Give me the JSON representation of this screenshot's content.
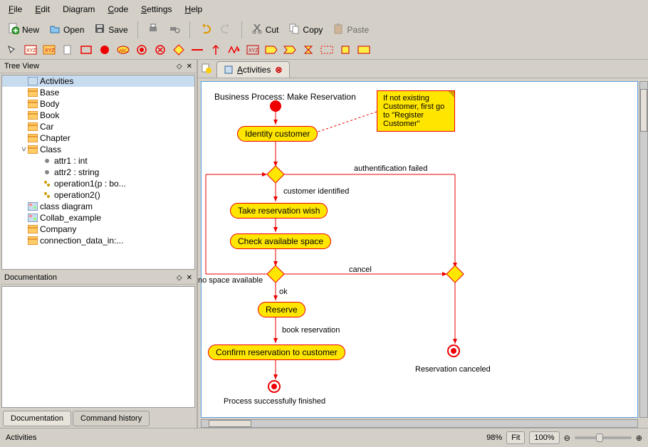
{
  "menu": [
    "File",
    "Edit",
    "Diagram",
    "Code",
    "Settings",
    "Help"
  ],
  "toolbar1": {
    "new": "New",
    "open": "Open",
    "save": "Save",
    "cut": "Cut",
    "copy": "Copy",
    "paste": "Paste"
  },
  "tree": {
    "title": "Tree View",
    "items": [
      {
        "label": "Activities",
        "indent": 34,
        "sel": true,
        "icon": "act"
      },
      {
        "label": "Base",
        "indent": 34,
        "icon": "cls"
      },
      {
        "label": "Body",
        "indent": 34,
        "icon": "cls"
      },
      {
        "label": "Book",
        "indent": 34,
        "icon": "cls"
      },
      {
        "label": "Car",
        "indent": 34,
        "icon": "cls"
      },
      {
        "label": "Chapter",
        "indent": 34,
        "icon": "cls"
      },
      {
        "label": "Class",
        "indent": 34,
        "icon": "cls",
        "expander": "˅"
      },
      {
        "label": "attr1 : int",
        "indent": 54,
        "icon": "attr"
      },
      {
        "label": "attr2 : string",
        "indent": 54,
        "icon": "attr"
      },
      {
        "label": "operation1(p : bo...",
        "indent": 54,
        "icon": "op"
      },
      {
        "label": "operation2()",
        "indent": 54,
        "icon": "op"
      },
      {
        "label": "class diagram",
        "indent": 34,
        "icon": "diag"
      },
      {
        "label": "Collab_example",
        "indent": 34,
        "icon": "diag"
      },
      {
        "label": "Company",
        "indent": 34,
        "icon": "cls"
      },
      {
        "label": "connection_data_in:...",
        "indent": 34,
        "icon": "cls"
      }
    ]
  },
  "doc": {
    "title": "Documentation"
  },
  "bottom_tabs": {
    "doc": "Documentation",
    "hist": "Command history"
  },
  "tab": {
    "label": "Activities"
  },
  "diagram": {
    "title": "Business Process: Make Reservation",
    "identity": "Identity customer",
    "take": "Take reservation wish",
    "check": "Check available space",
    "reserve": "Reserve",
    "confirm": "Confirm reservation to customer",
    "note": "If not existing Customer, first go to \"Register Customer\"",
    "auth_failed": "authentification failed",
    "cust_id": "customer identified",
    "cancel": "cancel",
    "no_space": "no space available",
    "ok": "ok",
    "book": "book reservation",
    "success": "Process successfully finished",
    "res_cancel": "Reservation canceled"
  },
  "status": {
    "left": "Activities",
    "zoom_pct": "98%",
    "fit": "Fit",
    "z100": "100%"
  }
}
